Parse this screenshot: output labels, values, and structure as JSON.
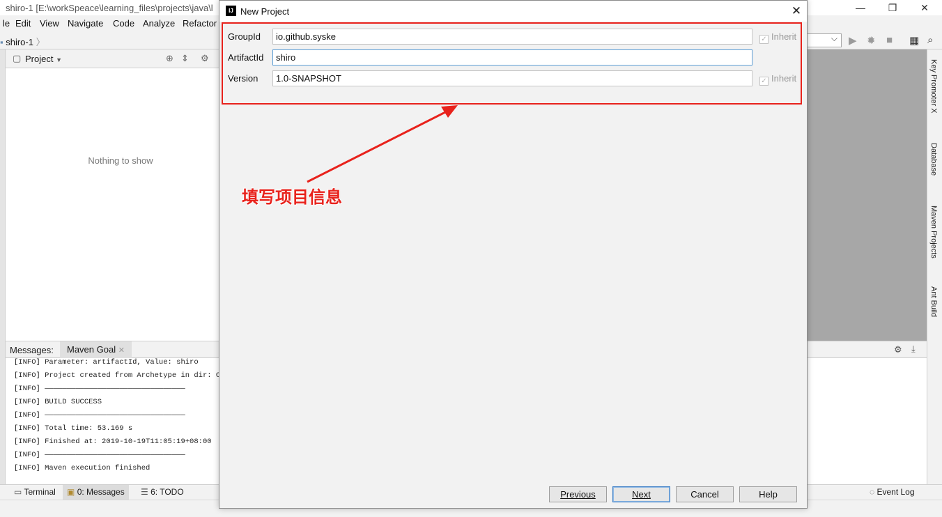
{
  "ide": {
    "title": "shiro-1 [E:\\workSpeace\\learning_files\\projects\\java\\l",
    "menu": [
      "le",
      "Edit",
      "View",
      "Navigate",
      "Code",
      "Analyze",
      "Refactor"
    ],
    "breadcrumb": "shiro-1",
    "project_panel": {
      "title": "Project",
      "empty_text": "Nothing to show"
    },
    "right_tools": [
      "Key Promoter X",
      "Database",
      "Maven Projects",
      "Ant Build"
    ],
    "messages": {
      "label": "Messages:",
      "tab": "Maven Goal"
    },
    "log_lines": [
      "[INFO] Parameter: artifactId, Value: shiro",
      "[INFO] Project created from Archetype in dir: C:\\",
      "[INFO] ————————————————————————————————",
      "[INFO] BUILD SUCCESS",
      "[INFO] ————————————————————————————————",
      "[INFO] Total time: 53.169 s",
      "[INFO] Finished at: 2019-10-19T11:05:19+08:00",
      "[INFO] ————————————————————————————————",
      "[INFO] Maven execution finished"
    ],
    "status": {
      "terminal": "Terminal",
      "messages": "0: Messages",
      "todo": "6: TODO",
      "event_log": "Event Log"
    }
  },
  "dialog": {
    "title": "New Project",
    "logo": "IJ",
    "fields": {
      "group_id": {
        "label": "GroupId",
        "value": "io.github.syske",
        "inherit": "Inherit"
      },
      "artifact_id": {
        "label": "ArtifactId",
        "value": "shiro"
      },
      "version": {
        "label": "Version",
        "value": "1.0-SNAPSHOT",
        "inherit": "Inherit"
      }
    },
    "annotation": "填写项目信息",
    "buttons": {
      "previous": "Previous",
      "next": "Next",
      "cancel": "Cancel",
      "help": "Help"
    }
  },
  "colors": {
    "annotation": "#e8221c",
    "focus": "#5a9cd4"
  }
}
